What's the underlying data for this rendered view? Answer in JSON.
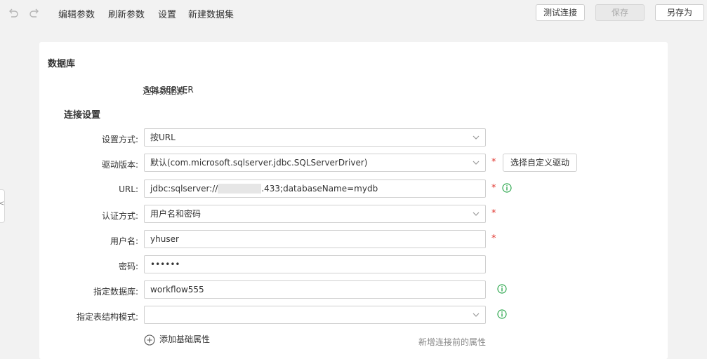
{
  "toolbar": {
    "menu": [
      "编辑参数",
      "刷新参数",
      "设置",
      "新建数据集"
    ],
    "test_connection": "测试连接",
    "save": "保存",
    "save_as": "另存为"
  },
  "sidetab": {
    "glyph": "<"
  },
  "database": {
    "title": "数据库",
    "datasource_label": "选择数据源:",
    "datasource_value": "SQLSERVER"
  },
  "connection": {
    "title": "连接设置",
    "mode": {
      "label": "设置方式:",
      "value": "按URL"
    },
    "driver": {
      "label": "驱动版本:",
      "value": "默认(com.microsoft.sqlserver.jdbc.SQLServerDriver)",
      "custom_button": "选择自定义驱动"
    },
    "url": {
      "label": "URL:",
      "prefix": "jdbc:sqlserver://",
      "suffix": ".433;databaseName=mydb"
    },
    "auth": {
      "label": "认证方式:",
      "value": "用户名和密码"
    },
    "username": {
      "label": "用户名:",
      "value": "yhuser"
    },
    "password": {
      "label": "密码:",
      "value": "••••••"
    },
    "database_name": {
      "label": "指定数据库:",
      "value": "workflow555"
    },
    "schema": {
      "label": "指定表结构模式:",
      "value": ""
    },
    "add_property": "添加基础属性",
    "pre_connect_hint": "新增连接前的属性",
    "required_mark": "*"
  },
  "colors": {
    "required": "#e0362f",
    "info": "#2fa84f"
  }
}
